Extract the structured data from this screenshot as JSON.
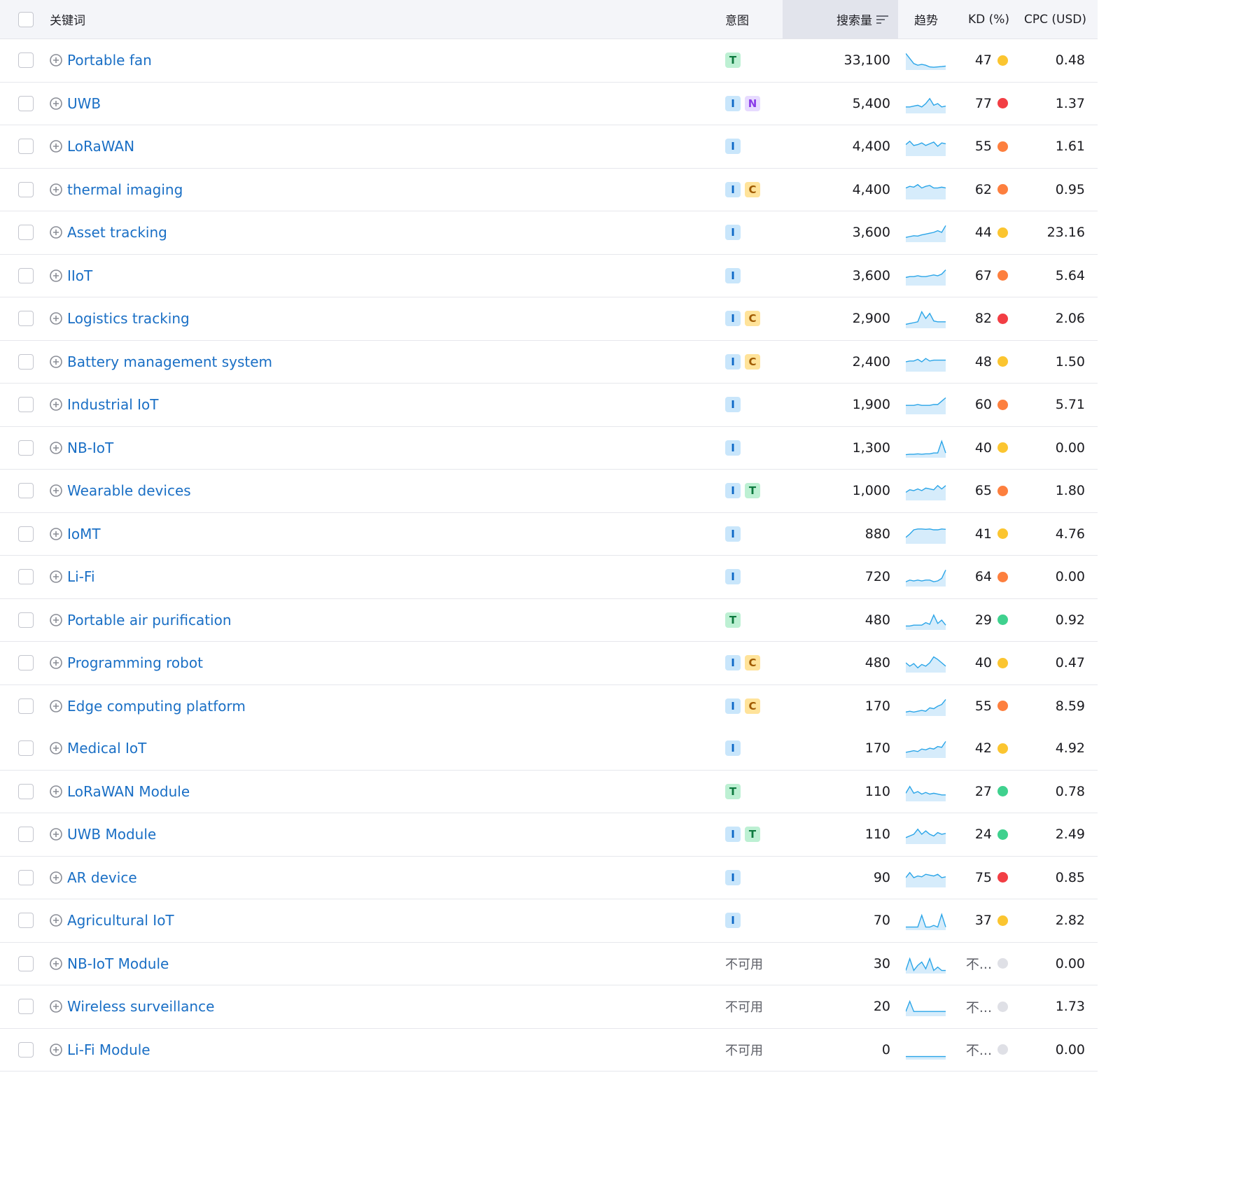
{
  "header": {
    "keyword": "关键词",
    "intent": "意图",
    "volume": "搜索量",
    "trend": "趋势",
    "kd": "KD (%)",
    "cpc": "CPC (USD)"
  },
  "kd_colors": {
    "yellow": "#fbc530",
    "orange": "#fd7f3e",
    "red": "#f23e44",
    "green": "#3fd18e",
    "gray": "#dfe0e6"
  },
  "trend_color": "#2aa5e8",
  "rows": [
    {
      "keyword": "Portable fan",
      "intents": [
        "T"
      ],
      "intent_text": "",
      "volume": "33,100",
      "trend": [
        0.9,
        0.6,
        0.3,
        0.2,
        0.25,
        0.2,
        0.1,
        0.08,
        0.1,
        0.12,
        0.15
      ],
      "kd": "47",
      "kd_color": "yellow",
      "cpc": "0.48"
    },
    {
      "keyword": "UWB",
      "intents": [
        "I",
        "N"
      ],
      "intent_text": "",
      "volume": "5,400",
      "trend": [
        0.3,
        0.3,
        0.35,
        0.4,
        0.3,
        0.5,
        0.8,
        0.4,
        0.5,
        0.3,
        0.35
      ],
      "kd": "77",
      "kd_color": "red",
      "cpc": "1.37"
    },
    {
      "keyword": "LoRaWAN",
      "intents": [
        "I"
      ],
      "intent_text": "",
      "volume": "4,400",
      "trend": [
        0.6,
        0.8,
        0.55,
        0.6,
        0.7,
        0.55,
        0.65,
        0.75,
        0.5,
        0.7,
        0.65
      ],
      "kd": "55",
      "kd_color": "orange",
      "cpc": "1.61"
    },
    {
      "keyword": "thermal imaging",
      "intents": [
        "I",
        "C"
      ],
      "intent_text": "",
      "volume": "4,400",
      "trend": [
        0.6,
        0.7,
        0.65,
        0.8,
        0.6,
        0.7,
        0.75,
        0.6,
        0.6,
        0.65,
        0.6
      ],
      "kd": "62",
      "kd_color": "orange",
      "cpc": "0.95"
    },
    {
      "keyword": "Asset tracking",
      "intents": [
        "I"
      ],
      "intent_text": "",
      "volume": "3,600",
      "trend": [
        0.2,
        0.25,
        0.3,
        0.28,
        0.35,
        0.4,
        0.45,
        0.5,
        0.6,
        0.5,
        0.9
      ],
      "kd": "44",
      "kd_color": "yellow",
      "cpc": "23.16"
    },
    {
      "keyword": "IIoT",
      "intents": [
        "I"
      ],
      "intent_text": "",
      "volume": "3,600",
      "trend": [
        0.4,
        0.45,
        0.45,
        0.5,
        0.45,
        0.45,
        0.5,
        0.55,
        0.5,
        0.6,
        0.85
      ],
      "kd": "67",
      "kd_color": "orange",
      "cpc": "5.64"
    },
    {
      "keyword": "Logistics tracking",
      "intents": [
        "I",
        "C"
      ],
      "intent_text": "",
      "volume": "2,900",
      "trend": [
        0.15,
        0.2,
        0.25,
        0.3,
        0.9,
        0.5,
        0.8,
        0.35,
        0.3,
        0.3,
        0.3
      ],
      "kd": "82",
      "kd_color": "red",
      "cpc": "2.06"
    },
    {
      "keyword": "Battery management system",
      "intents": [
        "I",
        "C"
      ],
      "intent_text": "",
      "volume": "2,400",
      "trend": [
        0.5,
        0.55,
        0.55,
        0.65,
        0.5,
        0.7,
        0.55,
        0.6,
        0.6,
        0.6,
        0.6
      ],
      "kd": "48",
      "kd_color": "yellow",
      "cpc": "1.50"
    },
    {
      "keyword": "Industrial IoT",
      "intents": [
        "I"
      ],
      "intent_text": "",
      "volume": "1,900",
      "trend": [
        0.45,
        0.45,
        0.45,
        0.5,
        0.45,
        0.45,
        0.45,
        0.5,
        0.5,
        0.7,
        0.9
      ],
      "kd": "60",
      "kd_color": "orange",
      "cpc": "5.71"
    },
    {
      "keyword": "NB-IoT",
      "intents": [
        "I"
      ],
      "intent_text": "",
      "volume": "1,300",
      "trend": [
        0.1,
        0.12,
        0.12,
        0.15,
        0.12,
        0.15,
        0.15,
        0.2,
        0.2,
        0.9,
        0.2
      ],
      "kd": "40",
      "kd_color": "yellow",
      "cpc": "0.00"
    },
    {
      "keyword": "Wearable devices",
      "intents": [
        "I",
        "T"
      ],
      "intent_text": "",
      "volume": "1,000",
      "trend": [
        0.4,
        0.55,
        0.5,
        0.6,
        0.5,
        0.65,
        0.6,
        0.55,
        0.8,
        0.6,
        0.8
      ],
      "kd": "65",
      "kd_color": "orange",
      "cpc": "1.80"
    },
    {
      "keyword": "IoMT",
      "intents": [
        "I"
      ],
      "intent_text": "",
      "volume": "880",
      "trend": [
        0.3,
        0.5,
        0.75,
        0.8,
        0.8,
        0.78,
        0.8,
        0.75,
        0.75,
        0.8,
        0.78
      ],
      "kd": "41",
      "kd_color": "yellow",
      "cpc": "4.76"
    },
    {
      "keyword": "Li-Fi",
      "intents": [
        "I"
      ],
      "intent_text": "",
      "volume": "720",
      "trend": [
        0.2,
        0.3,
        0.25,
        0.3,
        0.25,
        0.3,
        0.3,
        0.2,
        0.25,
        0.4,
        0.9
      ],
      "kd": "64",
      "kd_color": "orange",
      "cpc": "0.00"
    },
    {
      "keyword": "Portable air purification",
      "intents": [
        "T"
      ],
      "intent_text": "",
      "volume": "480",
      "trend": [
        0.15,
        0.15,
        0.2,
        0.2,
        0.2,
        0.35,
        0.25,
        0.8,
        0.3,
        0.5,
        0.2
      ],
      "kd": "29",
      "kd_color": "green",
      "cpc": "0.92"
    },
    {
      "keyword": "Programming robot",
      "intents": [
        "I",
        "C"
      ],
      "intent_text": "",
      "volume": "480",
      "trend": [
        0.5,
        0.3,
        0.45,
        0.2,
        0.4,
        0.3,
        0.5,
        0.85,
        0.7,
        0.5,
        0.3
      ],
      "kd": "40",
      "kd_color": "yellow",
      "cpc": "0.47"
    },
    {
      "keyword": "Edge computing platform",
      "intents": [
        "I",
        "C"
      ],
      "intent_text": "",
      "volume": "170",
      "trend": [
        0.15,
        0.2,
        0.15,
        0.2,
        0.25,
        0.2,
        0.4,
        0.35,
        0.5,
        0.6,
        0.9
      ],
      "kd": "55",
      "kd_color": "orange",
      "cpc": "8.59"
    },
    {
      "keyword": "Medical IoT",
      "intents": [
        "I"
      ],
      "intent_text": "",
      "volume": "170",
      "trend": [
        0.25,
        0.3,
        0.35,
        0.3,
        0.45,
        0.4,
        0.5,
        0.45,
        0.6,
        0.55,
        0.9
      ],
      "kd": "42",
      "kd_color": "yellow",
      "cpc": "4.92"
    },
    {
      "keyword": "LoRaWAN Module",
      "intents": [
        "T"
      ],
      "intent_text": "",
      "volume": "110",
      "trend": [
        0.4,
        0.8,
        0.4,
        0.5,
        0.35,
        0.45,
        0.35,
        0.4,
        0.35,
        0.3,
        0.3
      ],
      "kd": "27",
      "kd_color": "green",
      "cpc": "0.78"
    },
    {
      "keyword": "UWB Module",
      "intents": [
        "I",
        "T"
      ],
      "intent_text": "",
      "volume": "110",
      "trend": [
        0.3,
        0.4,
        0.5,
        0.8,
        0.5,
        0.7,
        0.5,
        0.4,
        0.6,
        0.5,
        0.55
      ],
      "kd": "24",
      "kd_color": "green",
      "cpc": "2.49"
    },
    {
      "keyword": "AR device",
      "intents": [
        "I"
      ],
      "intent_text": "",
      "volume": "90",
      "trend": [
        0.5,
        0.8,
        0.5,
        0.6,
        0.55,
        0.7,
        0.65,
        0.6,
        0.7,
        0.5,
        0.55
      ],
      "kd": "75",
      "kd_color": "red",
      "cpc": "0.85"
    },
    {
      "keyword": "Agricultural IoT",
      "intents": [
        "I"
      ],
      "intent_text": "",
      "volume": "70",
      "trend": [
        0.1,
        0.1,
        0.1,
        0.1,
        0.8,
        0.1,
        0.1,
        0.2,
        0.1,
        0.85,
        0.1
      ],
      "kd": "37",
      "kd_color": "yellow",
      "cpc": "2.82"
    },
    {
      "keyword": "NB-IoT Module",
      "intents": [],
      "intent_text": "不可用",
      "volume": "30",
      "trend": [
        0.1,
        0.8,
        0.1,
        0.4,
        0.6,
        0.2,
        0.8,
        0.1,
        0.3,
        0.1,
        0.1
      ],
      "kd": "不...",
      "kd_color": "gray",
      "cpc": "0.00"
    },
    {
      "keyword": "Wireless surveillance",
      "intents": [],
      "intent_text": "不可用",
      "volume": "20",
      "trend": [
        0.2,
        0.8,
        0.2,
        0.2,
        0.2,
        0.2,
        0.2,
        0.2,
        0.2,
        0.2,
        0.2
      ],
      "kd": "不...",
      "kd_color": "gray",
      "cpc": "1.73"
    },
    {
      "keyword": "Li-Fi Module",
      "intents": [],
      "intent_text": "不可用",
      "volume": "0",
      "trend": [
        0.1,
        0.1,
        0.1,
        0.1,
        0.1,
        0.1,
        0.1,
        0.1,
        0.1,
        0.1,
        0.1
      ],
      "kd": "不...",
      "kd_color": "gray",
      "cpc": "0.00"
    }
  ]
}
